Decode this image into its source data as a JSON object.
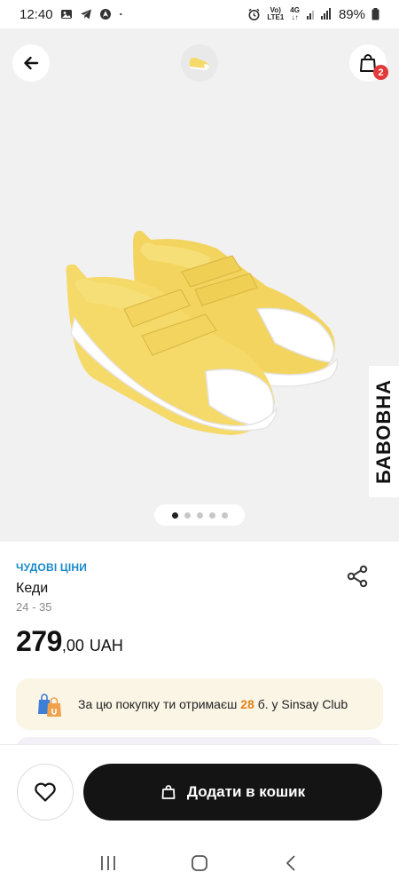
{
  "status_bar": {
    "time": "12:40",
    "network_top": "Vo)",
    "network_bottom": "LTE1",
    "network_type": "4G",
    "battery": "89%",
    "icons": [
      "gallery-icon",
      "telegram-icon",
      "navigation-icon",
      "dot-icon",
      "alarm-icon",
      "signal-icon",
      "battery-icon"
    ]
  },
  "header": {
    "back_icon": "arrow-left-icon",
    "cart_icon": "shopping-bag-icon",
    "cart_count": "2"
  },
  "gallery": {
    "side_label": "БАВОВНА",
    "dots_total": 5,
    "active_dot": 0,
    "product_color": "#f5d969"
  },
  "product": {
    "promo_label": "ЧУДОВІ ЦІНИ",
    "name": "Кеди",
    "sizes": "24 - 35",
    "price_int": "279",
    "price_dec": ",00",
    "currency": "UAH",
    "share_icon": "share-icon"
  },
  "club": {
    "text_before": "За цю покупку ти отримаєш ",
    "points": "28",
    "text_after": " б. у Sinsay Club"
  },
  "actions": {
    "wishlist_icon": "heart-icon",
    "add_to_cart_label": "Додати в кошик",
    "add_icon": "shopping-bag-icon"
  },
  "nav": {
    "items": [
      "recent-apps-icon",
      "home-icon",
      "back-icon"
    ]
  },
  "colors": {
    "accent_blue": "#1a88c9",
    "badge_red": "#e23a3a",
    "points_orange": "#e0821b",
    "button_dark": "#141414"
  }
}
